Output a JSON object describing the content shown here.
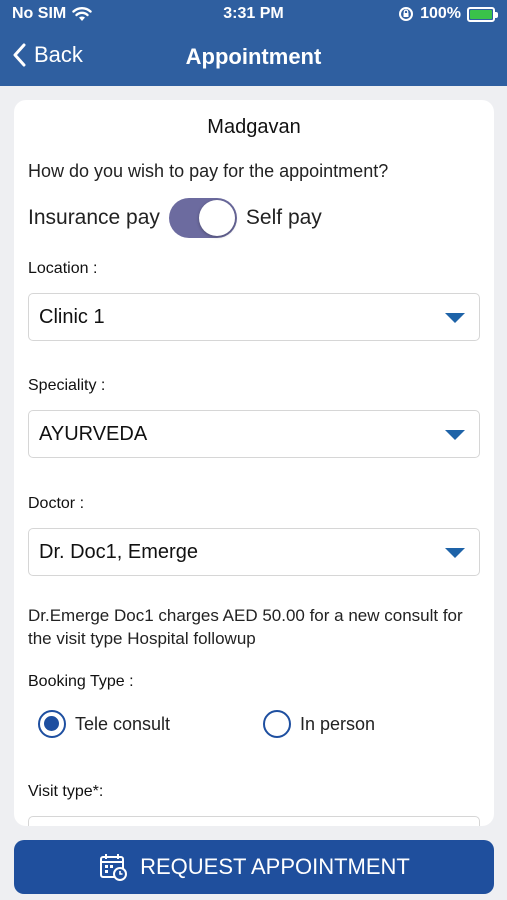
{
  "status": {
    "carrier": "No SIM",
    "time": "3:31 PM",
    "battery": "100%"
  },
  "nav": {
    "back_label": "Back",
    "title": "Appointment"
  },
  "clinic_name": "Madgavan",
  "payment": {
    "question": "How do you wish to pay for the appointment?",
    "left_label": "Insurance pay",
    "right_label": "Self pay",
    "selected": "Self pay"
  },
  "location": {
    "label": "Location :",
    "value": "Clinic 1"
  },
  "speciality": {
    "label": "Speciality :",
    "value": "AYURVEDA"
  },
  "doctor": {
    "label": "Doctor :",
    "value": "Dr. Doc1, Emerge"
  },
  "charge_info": "Dr.Emerge Doc1 charges AED 50.00 for a new consult for the visit type Hospital followup",
  "booking_type": {
    "label": "Booking Type :",
    "options": [
      "Tele consult",
      "In person"
    ],
    "selected": "Tele consult"
  },
  "visit_type": {
    "label": "Visit type*:"
  },
  "request_button": {
    "label": "REQUEST APPOINTMENT"
  },
  "colors": {
    "header": "#2f5fa0",
    "toggle": "#6c6b9f",
    "accent": "#1f4f9d",
    "battery": "#3ac24a"
  }
}
